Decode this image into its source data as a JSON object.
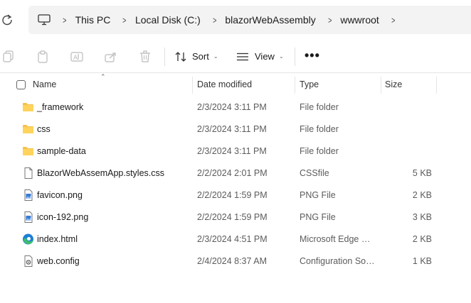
{
  "breadcrumb": {
    "items": [
      "This PC",
      "Local Disk (C:)",
      "blazorWebAssembly",
      "wwwroot"
    ]
  },
  "toolbar": {
    "sort_label": "Sort",
    "view_label": "View",
    "more_label": "•••"
  },
  "columns": {
    "name": "Name",
    "date": "Date modified",
    "type": "Type",
    "size": "Size"
  },
  "files": [
    {
      "name": "_framework",
      "date": "2/3/2024 3:11 PM",
      "type": "File folder",
      "size": "",
      "icon": "folder-icon"
    },
    {
      "name": "css",
      "date": "2/3/2024 3:11 PM",
      "type": "File folder",
      "size": "",
      "icon": "folder-icon"
    },
    {
      "name": "sample-data",
      "date": "2/3/2024 3:11 PM",
      "type": "File folder",
      "size": "",
      "icon": "folder-icon"
    },
    {
      "name": "BlazorWebAssemApp.styles.css",
      "date": "2/2/2024 2:01 PM",
      "type": "CSSfile",
      "size": "5 KB",
      "icon": "document-icon"
    },
    {
      "name": "favicon.png",
      "date": "2/2/2024 1:59 PM",
      "type": "PNG File",
      "size": "2 KB",
      "icon": "image-file-icon"
    },
    {
      "name": "icon-192.png",
      "date": "2/2/2024 1:59 PM",
      "type": "PNG File",
      "size": "3 KB",
      "icon": "image-file-icon"
    },
    {
      "name": "index.html",
      "date": "2/3/2024 4:51 PM",
      "type": "Microsoft Edge H...",
      "size": "2 KB",
      "icon": "edge-icon"
    },
    {
      "name": "web.config",
      "date": "2/4/2024 8:37 AM",
      "type": "Configuration Sou...",
      "size": "1 KB",
      "icon": "config-file-icon"
    }
  ],
  "colors": {
    "folder": "#f5c04a",
    "edge_blue": "#1c7fd6",
    "edge_green": "#3fbf6a"
  }
}
